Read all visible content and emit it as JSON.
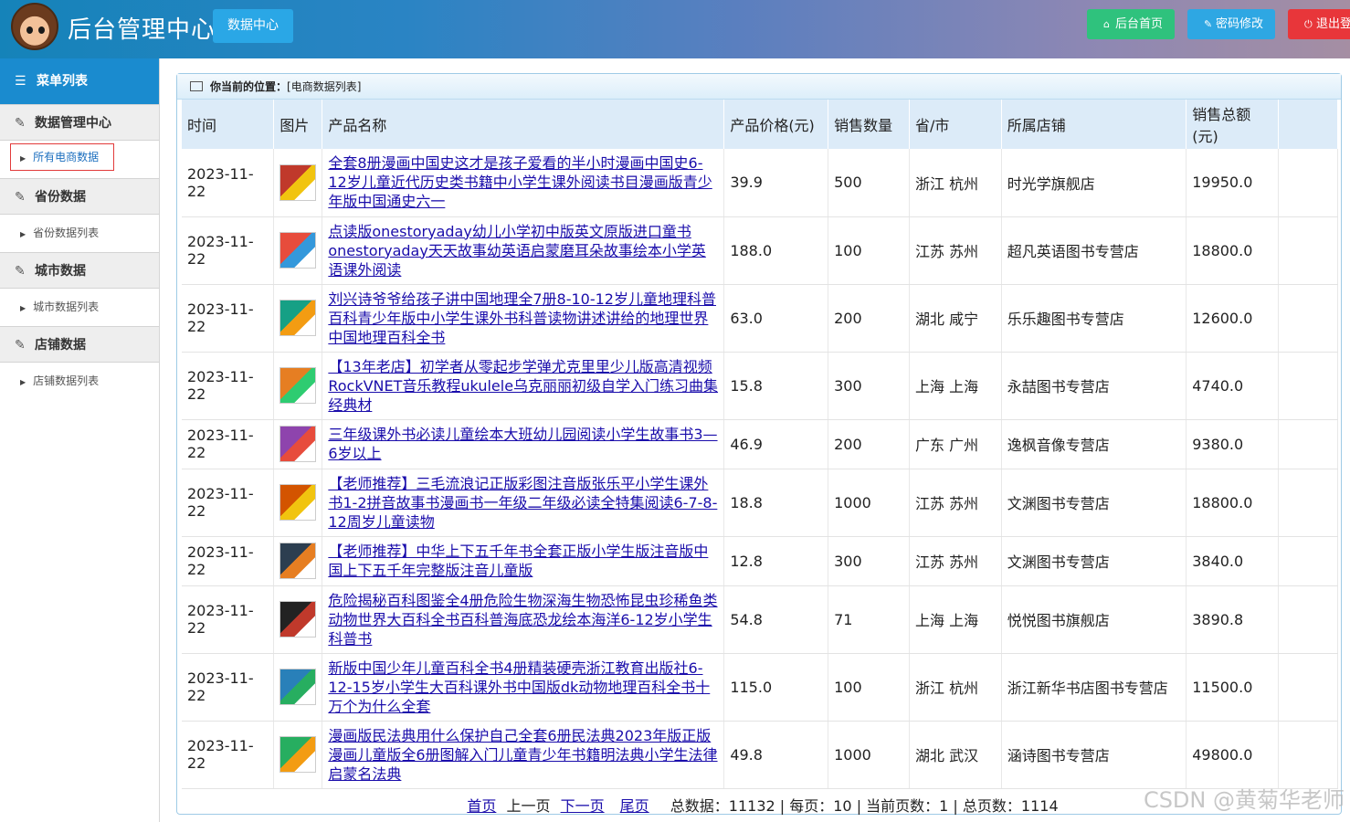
{
  "header": {
    "title": "后台管理中心",
    "nav_data": "数据中心",
    "btn_home": "后台首页",
    "btn_password": "密码修改",
    "btn_logout": "退出登"
  },
  "sidebar": {
    "menu_title": "菜单列表",
    "groups": [
      {
        "label": "数据管理中心",
        "sub": "所有电商数据"
      },
      {
        "label": "省份数据",
        "sub": "省份数据列表"
      },
      {
        "label": "城市数据",
        "sub": "城市数据列表"
      },
      {
        "label": "店铺数据",
        "sub": "店铺数据列表"
      }
    ]
  },
  "breadcrumb": {
    "label": "你当前的位置：",
    "value": "[电商数据列表]"
  },
  "table": {
    "headers": [
      "时间",
      "图片",
      "产品名称",
      "产品价格(元)",
      "销售数量",
      "省/市",
      "所属店铺",
      "销售总额(元)"
    ],
    "rows": [
      {
        "time": "2023-11-22",
        "name": "全套8册漫画中国史这才是孩子爱看的半小时漫画中国史6-12岁儿童近代历史类书籍中小学生课外阅读书目漫画版青少年版中国通史六一",
        "price": "39.9",
        "qty": "500",
        "region": "浙江 杭州",
        "shop": "时光学旗舰店",
        "total": "19950.0"
      },
      {
        "time": "2023-11-22",
        "name": "点读版onestoryaday幼儿小学初中版英文原版进口童书onestoryaday天天故事幼英语启蒙磨耳朵故事绘本小学英语课外阅读",
        "price": "188.0",
        "qty": "100",
        "region": "江苏 苏州",
        "shop": "超凡英语图书专营店",
        "total": "18800.0"
      },
      {
        "time": "2023-11-22",
        "name": "刘兴诗爷爷给孩子讲中国地理全7册8-10-12岁儿童地理科普百科青少年版中小学生课外书科普读物讲述讲给的地理世界中国地理百科全书",
        "price": "63.0",
        "qty": "200",
        "region": "湖北 咸宁",
        "shop": "乐乐趣图书专营店",
        "total": "12600.0"
      },
      {
        "time": "2023-11-22",
        "name": "【13年老店】初学者从零起步学弹尤克里里少儿版高清视频RockVNET音乐教程ukulele乌克丽丽初级自学入门练习曲集经典材",
        "price": "15.8",
        "qty": "300",
        "region": "上海 上海",
        "shop": "永喆图书专营店",
        "total": "4740.0"
      },
      {
        "time": "2023-11-22",
        "name": "三年级课外书必读儿童绘本大班幼儿园阅读小学生故事书3—6岁以上",
        "price": "46.9",
        "qty": "200",
        "region": "广东 广州",
        "shop": "逸枫音像专营店",
        "total": "9380.0"
      },
      {
        "time": "2023-11-22",
        "name": "【老师推荐】三毛流浪记正版彩图注音版张乐平小学生课外书1-2拼音故事书漫画书一年级二年级必读全特集阅读6-7-8-12周岁儿童读物",
        "price": "18.8",
        "qty": "1000",
        "region": "江苏 苏州",
        "shop": "文渊图书专营店",
        "total": "18800.0"
      },
      {
        "time": "2023-11-22",
        "name": "【老师推荐】中华上下五千年书全套正版小学生版注音版中国上下五千年完整版注音儿童版",
        "price": "12.8",
        "qty": "300",
        "region": "江苏 苏州",
        "shop": "文渊图书专营店",
        "total": "3840.0"
      },
      {
        "time": "2023-11-22",
        "name": "危险揭秘百科图鉴全4册危险生物深海生物恐怖昆虫珍稀鱼类动物世界大百科全书百科普海底恐龙绘本海洋6-12岁小学生科普书",
        "price": "54.8",
        "qty": "71",
        "region": "上海 上海",
        "shop": "悦悦图书旗舰店",
        "total": "3890.8"
      },
      {
        "time": "2023-11-22",
        "name": "新版中国少年儿童百科全书4册精装硬壳浙江教育出版社6-12-15岁小学生大百科课外书中国版dk动物地理百科全书十万个为什么全套",
        "price": "115.0",
        "qty": "100",
        "region": "浙江 杭州",
        "shop": "浙江新华书店图书专营店",
        "total": "11500.0"
      },
      {
        "time": "2023-11-22",
        "name": "漫画版民法典用什么保护自己全套6册民法典2023年版正版漫画儿童版全6册图解入门儿童青少年书籍明法典小学生法律启蒙名法典",
        "price": "49.8",
        "qty": "1000",
        "region": "湖北 武汉",
        "shop": "涵诗图书专营店",
        "total": "49800.0"
      }
    ]
  },
  "pager": {
    "first": "首页",
    "prev": "上一页",
    "next": "下一页",
    "last": "尾页",
    "stats": "总数据：11132 | 每页：10 | 当前页数：1 | 总页数：1114"
  },
  "watermark": "CSDN @黄菊华老师",
  "colors": {
    "accent": "#1a8bcf",
    "home_btn": "#2fc27d",
    "pwd_btn": "#2ea7e3",
    "logout_btn": "#e8363a"
  }
}
